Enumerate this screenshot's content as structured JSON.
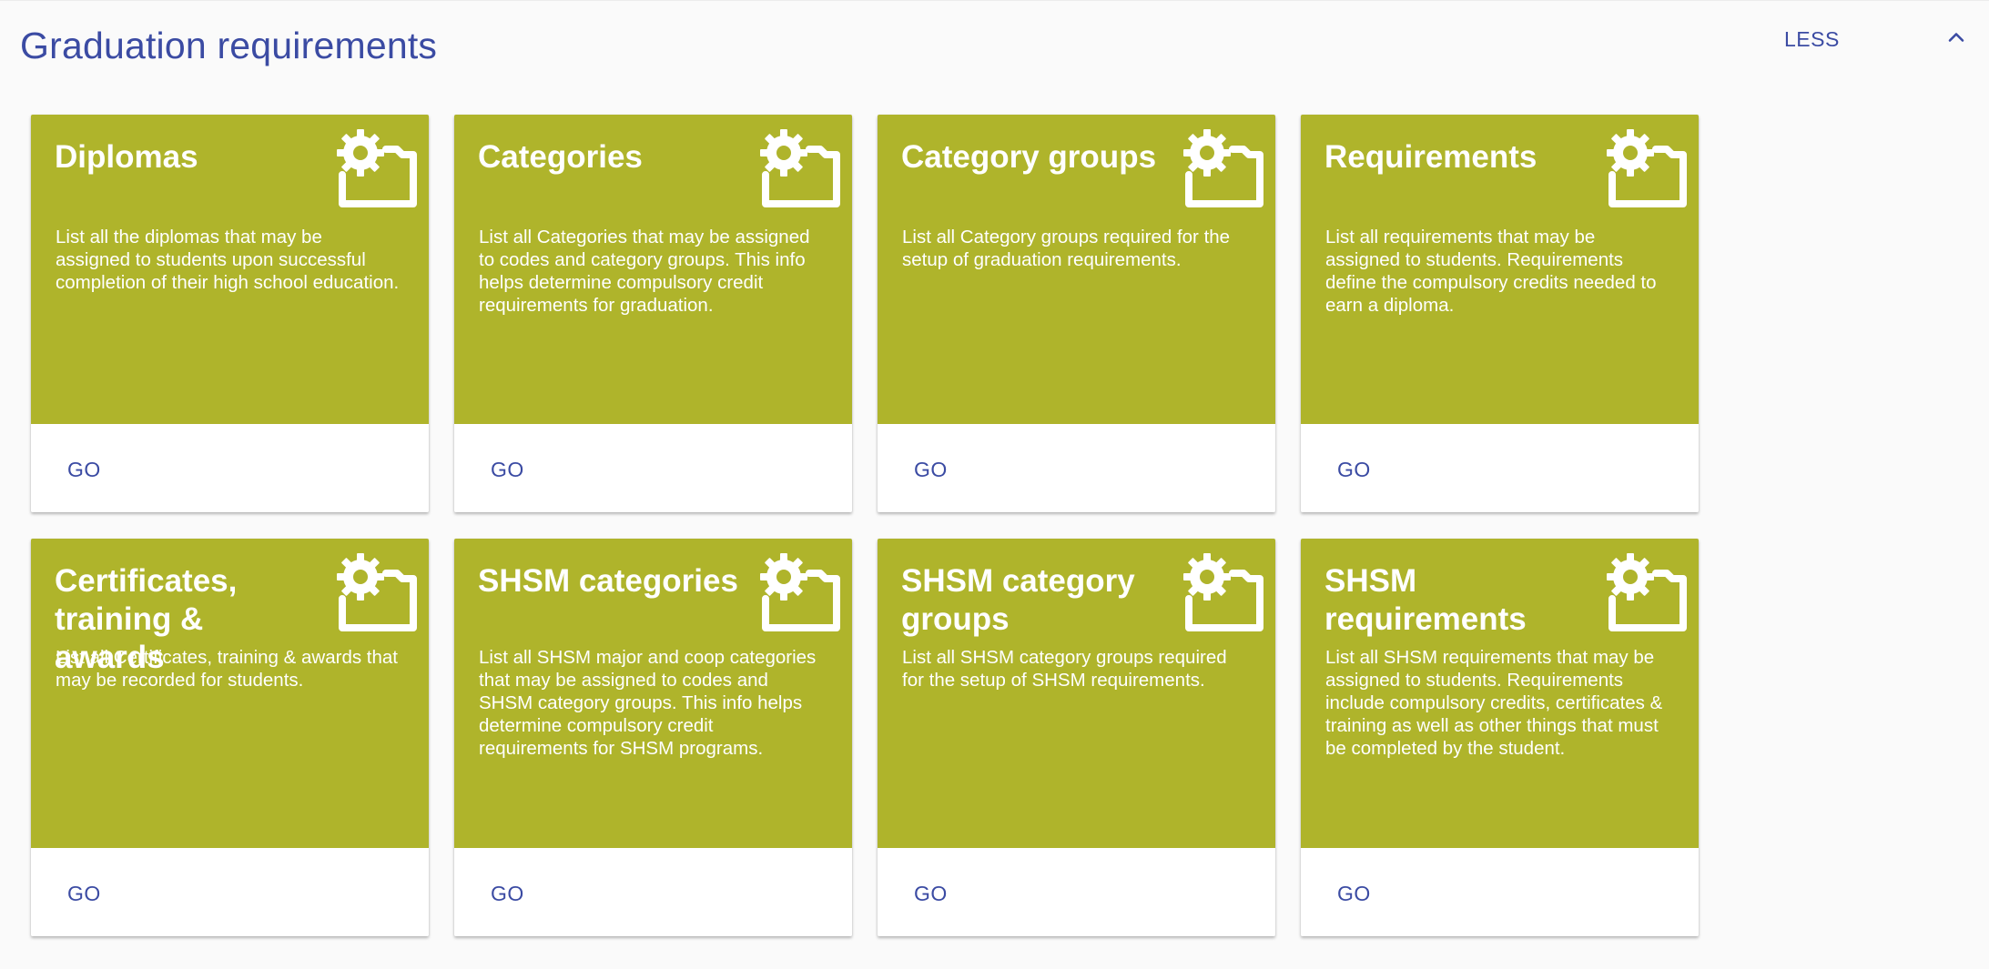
{
  "section": {
    "title": "Graduation requirements",
    "toggle_label": "LESS",
    "toggle_icon": "chevron-up-icon"
  },
  "colors": {
    "card_accent": "#afb42b",
    "primary_text": "#3b4ba3",
    "card_bottom": "#ffffff"
  },
  "cards": [
    {
      "title": "Diplomas",
      "description": "List all the diplomas that may be assigned to students upon successful completion of their high school education.",
      "action_label": "GO",
      "icon": "settings-folder-icon"
    },
    {
      "title": "Categories",
      "description": "List all Categories that may be assigned to codes and category groups. This info helps determine compulsory credit requirements for graduation.",
      "action_label": "GO",
      "icon": "settings-folder-icon"
    },
    {
      "title": "Category groups",
      "description": "List all Category groups required for the setup of graduation requirements.",
      "action_label": "GO",
      "icon": "settings-folder-icon"
    },
    {
      "title": "Requirements",
      "description": "List all requirements that may be assigned to students. Requirements define the compulsory credits needed to earn a diploma.",
      "action_label": "GO",
      "icon": "settings-folder-icon"
    },
    {
      "title": "Certificates, training & awards",
      "description": "List all Certificates, training & awards that may be recorded for students.",
      "action_label": "GO",
      "icon": "settings-folder-icon"
    },
    {
      "title": "SHSM categories",
      "description": "List all SHSM major and coop categories that may be assigned to codes and SHSM category groups. This info helps determine compulsory credit requirements for SHSM programs.",
      "action_label": "GO",
      "icon": "settings-folder-icon"
    },
    {
      "title": "SHSM category groups",
      "description": "List all SHSM category groups required for the setup of SHSM requirements.",
      "action_label": "GO",
      "icon": "settings-folder-icon"
    },
    {
      "title": "SHSM requirements",
      "description": "List all SHSM requirements that may be assigned to students. Requirements include compulsory credits, certificates & training as well as other things that must be completed by the student.",
      "action_label": "GO",
      "icon": "settings-folder-icon"
    }
  ]
}
